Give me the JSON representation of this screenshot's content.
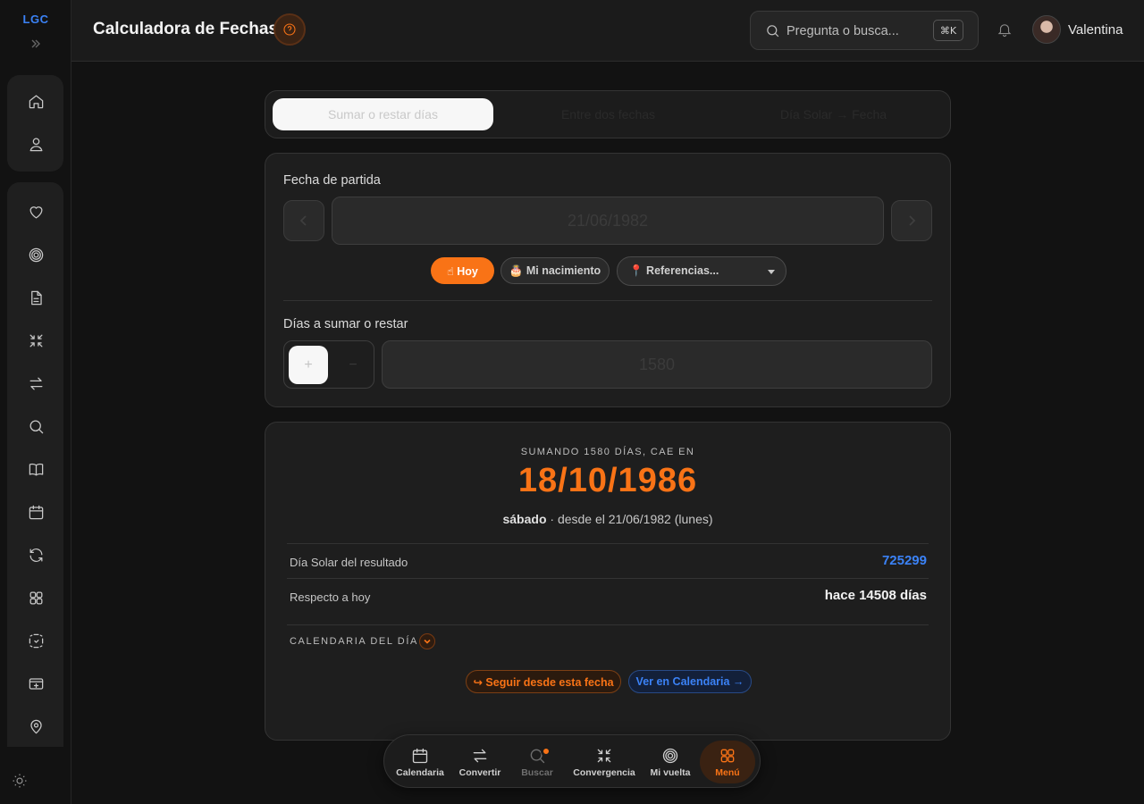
{
  "app": {
    "logo": "LGC",
    "accent": "#f97316",
    "link_color": "#3b82f6"
  },
  "header": {
    "title": "Calculadora de Fechas",
    "search_placeholder": "Pregunta o busca...",
    "shortcut": "⌘K",
    "user_name": "Valentina"
  },
  "sidebar": {
    "items": [
      {
        "icon": "home-icon"
      },
      {
        "icon": "user-icon"
      },
      {
        "icon": "heart-icon"
      },
      {
        "icon": "spiral-icon"
      },
      {
        "icon": "document-icon"
      },
      {
        "icon": "converge-icon"
      },
      {
        "icon": "swap-icon"
      },
      {
        "icon": "search-icon"
      },
      {
        "icon": "book-icon"
      },
      {
        "icon": "calendar-icon"
      },
      {
        "icon": "refresh-icon"
      },
      {
        "icon": "grid-icon"
      },
      {
        "icon": "scan-icon"
      },
      {
        "icon": "card-icon"
      },
      {
        "icon": "location-icon"
      }
    ]
  },
  "tabs": [
    {
      "label": "Sumar o restar días",
      "active": true
    },
    {
      "label": "Entre dos fechas",
      "active": false
    },
    {
      "label": "Día Solar → Fecha",
      "active": false
    }
  ],
  "form": {
    "start_label": "Fecha de partida",
    "start_value": "21/06/1982",
    "chips": {
      "hoy": "☝ Hoy",
      "birth": "🎂 Mi nacimiento",
      "refs": "📍 Referencias..."
    },
    "days_label": "Días a sumar o restar",
    "plus": "+",
    "minus": "−",
    "days_value": "1580"
  },
  "result": {
    "caption": "SUMANDO 1580 DÍAS, CAE EN",
    "date": "18/10/1986",
    "weekday": "sábado",
    "since": "· desde el 21/06/1982 (lunes)",
    "solar_label": "Día Solar del resultado",
    "solar_value": "725299",
    "relative_label": "Respecto a hoy",
    "relative_value": "hace 14508 días",
    "calendaria_label": "CALENDARIA DEL DÍA",
    "follow_button": "↪ Seguir desde esta fecha",
    "view_button": "Ver en Calendaria →"
  },
  "dock": [
    {
      "label": "Calendaria",
      "icon": "calendar-icon"
    },
    {
      "label": "Convertir",
      "icon": "swap-icon"
    },
    {
      "label": "Buscar",
      "icon": "search-icon"
    },
    {
      "label": "Convergencia",
      "icon": "converge-icon"
    },
    {
      "label": "Mi vuelta",
      "icon": "spiral-icon"
    },
    {
      "label": "Menú",
      "icon": "grid-icon"
    }
  ]
}
